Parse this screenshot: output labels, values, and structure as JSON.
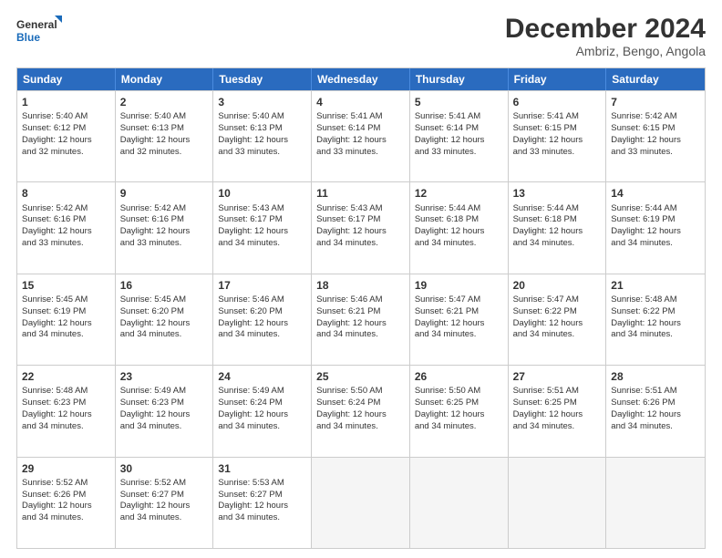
{
  "header": {
    "logo_line1": "General",
    "logo_line2": "Blue",
    "title": "December 2024",
    "subtitle": "Ambriz, Bengo, Angola"
  },
  "days_of_week": [
    "Sunday",
    "Monday",
    "Tuesday",
    "Wednesday",
    "Thursday",
    "Friday",
    "Saturday"
  ],
  "weeks": [
    [
      {
        "day": "1",
        "lines": [
          "Sunrise: 5:40 AM",
          "Sunset: 6:12 PM",
          "Daylight: 12 hours",
          "and 32 minutes."
        ]
      },
      {
        "day": "2",
        "lines": [
          "Sunrise: 5:40 AM",
          "Sunset: 6:13 PM",
          "Daylight: 12 hours",
          "and 32 minutes."
        ]
      },
      {
        "day": "3",
        "lines": [
          "Sunrise: 5:40 AM",
          "Sunset: 6:13 PM",
          "Daylight: 12 hours",
          "and 33 minutes."
        ]
      },
      {
        "day": "4",
        "lines": [
          "Sunrise: 5:41 AM",
          "Sunset: 6:14 PM",
          "Daylight: 12 hours",
          "and 33 minutes."
        ]
      },
      {
        "day": "5",
        "lines": [
          "Sunrise: 5:41 AM",
          "Sunset: 6:14 PM",
          "Daylight: 12 hours",
          "and 33 minutes."
        ]
      },
      {
        "day": "6",
        "lines": [
          "Sunrise: 5:41 AM",
          "Sunset: 6:15 PM",
          "Daylight: 12 hours",
          "and 33 minutes."
        ]
      },
      {
        "day": "7",
        "lines": [
          "Sunrise: 5:42 AM",
          "Sunset: 6:15 PM",
          "Daylight: 12 hours",
          "and 33 minutes."
        ]
      }
    ],
    [
      {
        "day": "8",
        "lines": [
          "Sunrise: 5:42 AM",
          "Sunset: 6:16 PM",
          "Daylight: 12 hours",
          "and 33 minutes."
        ]
      },
      {
        "day": "9",
        "lines": [
          "Sunrise: 5:42 AM",
          "Sunset: 6:16 PM",
          "Daylight: 12 hours",
          "and 33 minutes."
        ]
      },
      {
        "day": "10",
        "lines": [
          "Sunrise: 5:43 AM",
          "Sunset: 6:17 PM",
          "Daylight: 12 hours",
          "and 34 minutes."
        ]
      },
      {
        "day": "11",
        "lines": [
          "Sunrise: 5:43 AM",
          "Sunset: 6:17 PM",
          "Daylight: 12 hours",
          "and 34 minutes."
        ]
      },
      {
        "day": "12",
        "lines": [
          "Sunrise: 5:44 AM",
          "Sunset: 6:18 PM",
          "Daylight: 12 hours",
          "and 34 minutes."
        ]
      },
      {
        "day": "13",
        "lines": [
          "Sunrise: 5:44 AM",
          "Sunset: 6:18 PM",
          "Daylight: 12 hours",
          "and 34 minutes."
        ]
      },
      {
        "day": "14",
        "lines": [
          "Sunrise: 5:44 AM",
          "Sunset: 6:19 PM",
          "Daylight: 12 hours",
          "and 34 minutes."
        ]
      }
    ],
    [
      {
        "day": "15",
        "lines": [
          "Sunrise: 5:45 AM",
          "Sunset: 6:19 PM",
          "Daylight: 12 hours",
          "and 34 minutes."
        ]
      },
      {
        "day": "16",
        "lines": [
          "Sunrise: 5:45 AM",
          "Sunset: 6:20 PM",
          "Daylight: 12 hours",
          "and 34 minutes."
        ]
      },
      {
        "day": "17",
        "lines": [
          "Sunrise: 5:46 AM",
          "Sunset: 6:20 PM",
          "Daylight: 12 hours",
          "and 34 minutes."
        ]
      },
      {
        "day": "18",
        "lines": [
          "Sunrise: 5:46 AM",
          "Sunset: 6:21 PM",
          "Daylight: 12 hours",
          "and 34 minutes."
        ]
      },
      {
        "day": "19",
        "lines": [
          "Sunrise: 5:47 AM",
          "Sunset: 6:21 PM",
          "Daylight: 12 hours",
          "and 34 minutes."
        ]
      },
      {
        "day": "20",
        "lines": [
          "Sunrise: 5:47 AM",
          "Sunset: 6:22 PM",
          "Daylight: 12 hours",
          "and 34 minutes."
        ]
      },
      {
        "day": "21",
        "lines": [
          "Sunrise: 5:48 AM",
          "Sunset: 6:22 PM",
          "Daylight: 12 hours",
          "and 34 minutes."
        ]
      }
    ],
    [
      {
        "day": "22",
        "lines": [
          "Sunrise: 5:48 AM",
          "Sunset: 6:23 PM",
          "Daylight: 12 hours",
          "and 34 minutes."
        ]
      },
      {
        "day": "23",
        "lines": [
          "Sunrise: 5:49 AM",
          "Sunset: 6:23 PM",
          "Daylight: 12 hours",
          "and 34 minutes."
        ]
      },
      {
        "day": "24",
        "lines": [
          "Sunrise: 5:49 AM",
          "Sunset: 6:24 PM",
          "Daylight: 12 hours",
          "and 34 minutes."
        ]
      },
      {
        "day": "25",
        "lines": [
          "Sunrise: 5:50 AM",
          "Sunset: 6:24 PM",
          "Daylight: 12 hours",
          "and 34 minutes."
        ]
      },
      {
        "day": "26",
        "lines": [
          "Sunrise: 5:50 AM",
          "Sunset: 6:25 PM",
          "Daylight: 12 hours",
          "and 34 minutes."
        ]
      },
      {
        "day": "27",
        "lines": [
          "Sunrise: 5:51 AM",
          "Sunset: 6:25 PM",
          "Daylight: 12 hours",
          "and 34 minutes."
        ]
      },
      {
        "day": "28",
        "lines": [
          "Sunrise: 5:51 AM",
          "Sunset: 6:26 PM",
          "Daylight: 12 hours",
          "and 34 minutes."
        ]
      }
    ],
    [
      {
        "day": "29",
        "lines": [
          "Sunrise: 5:52 AM",
          "Sunset: 6:26 PM",
          "Daylight: 12 hours",
          "and 34 minutes."
        ]
      },
      {
        "day": "30",
        "lines": [
          "Sunrise: 5:52 AM",
          "Sunset: 6:27 PM",
          "Daylight: 12 hours",
          "and 34 minutes."
        ]
      },
      {
        "day": "31",
        "lines": [
          "Sunrise: 5:53 AM",
          "Sunset: 6:27 PM",
          "Daylight: 12 hours",
          "and 34 minutes."
        ]
      },
      {
        "day": "",
        "lines": []
      },
      {
        "day": "",
        "lines": []
      },
      {
        "day": "",
        "lines": []
      },
      {
        "day": "",
        "lines": []
      }
    ]
  ]
}
